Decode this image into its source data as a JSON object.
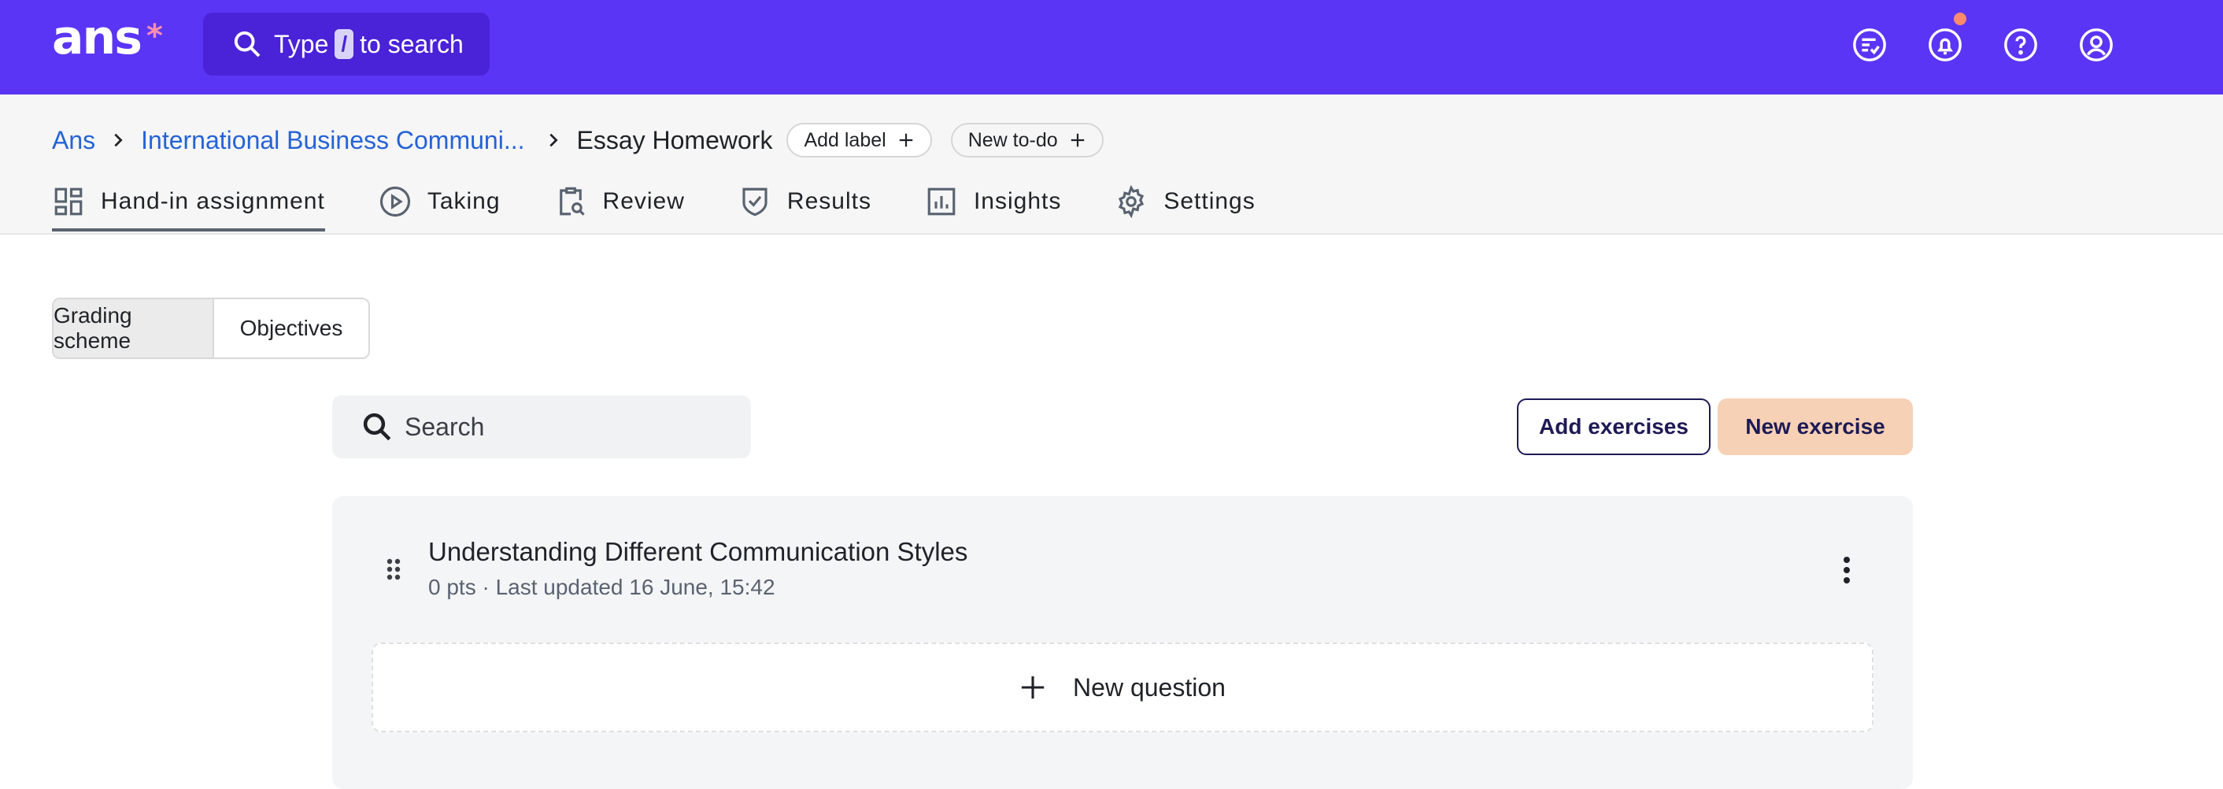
{
  "brand": {
    "logo_text": "ans",
    "accent": "#5b35f5"
  },
  "top_search": {
    "prefix": "Type",
    "key": "/",
    "suffix": "to search"
  },
  "top_icons": [
    "checklist-icon",
    "bell-icon",
    "help-icon",
    "user-icon"
  ],
  "breadcrumb": {
    "items": [
      "Ans",
      "International Business Communi..."
    ],
    "current": "Essay Homework",
    "add_label": "Add label",
    "new_todo": "New to-do"
  },
  "tabs": [
    {
      "label": "Hand-in assignment",
      "icon": "dashboard-icon",
      "active": true
    },
    {
      "label": "Taking",
      "icon": "play-icon"
    },
    {
      "label": "Review",
      "icon": "clipboard-search-icon"
    },
    {
      "label": "Results",
      "icon": "shield-check-icon"
    },
    {
      "label": "Insights",
      "icon": "bar-chart-icon"
    },
    {
      "label": "Settings",
      "icon": "gear-icon"
    }
  ],
  "segmented": {
    "grading_scheme": "Grading scheme",
    "objectives": "Objectives"
  },
  "search": {
    "placeholder": "Search"
  },
  "buttons": {
    "add_exercises": "Add exercises",
    "new_exercise": "New exercise"
  },
  "exercise": {
    "title": "Understanding Different Communication Styles",
    "meta": "0 pts · Last updated 16 June, 15:42",
    "new_question": "New question"
  }
}
